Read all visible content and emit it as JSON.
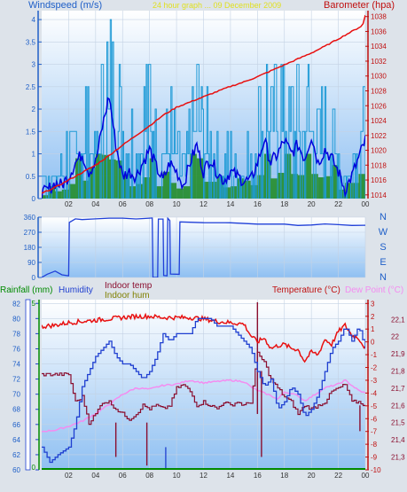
{
  "colors": {
    "page_bg": "#dde3ea",
    "plot_bg_top": "#ffffff",
    "plot_bg_bottom": "#8fc0f2",
    "grid": "#c4d2e4",
    "wind_gust": "#1e9ad6",
    "wind_avg": "#0000dd",
    "wind_bar": "#1d8a1d",
    "barometer": "#e81010",
    "direction": "#2040d8",
    "temperature": "#e81010",
    "dew_point": "#f48cf0",
    "humidity": "#1f3fd0",
    "rainfall": "#008a00",
    "indoor_temp": "#8a0d2e",
    "indoor_hum": "#808000",
    "axis_blue": "#2060c8",
    "axis_red": "#c01010",
    "tick_text": "#333333"
  },
  "chart_data": [
    {
      "type": "line",
      "title": "24 hour graph ... 09 December 2009",
      "y_left_label": "Windspeed (m/s)",
      "y_right_label": "Barometer (hpa)",
      "x_ticks": [
        "02",
        "04",
        "06",
        "08",
        "10",
        "12",
        "14",
        "16",
        "18",
        "20",
        "22",
        "00"
      ],
      "y_left_ticks": [
        "0",
        "0.5",
        "1",
        "1.5",
        "2",
        "2.5",
        "3",
        "3.5",
        "4"
      ],
      "y_left_range": [
        0,
        4.2
      ],
      "y_right_ticks": [
        "1014",
        "1016",
        "1018",
        "1020",
        "1022",
        "1024",
        "1026",
        "1028",
        "1030",
        "1032",
        "1034",
        "1036",
        "1038"
      ],
      "y_right_range": [
        1013.5,
        1038.8
      ],
      "x_range_hours": [
        0,
        24
      ],
      "barometer": [
        [
          0,
          1014.2
        ],
        [
          1,
          1015.0
        ],
        [
          2,
          1016.0
        ],
        [
          3,
          1017.0
        ],
        [
          4,
          1018.0
        ],
        [
          5,
          1019.3
        ],
        [
          6,
          1020.7
        ],
        [
          7,
          1022.0
        ],
        [
          8,
          1023.3
        ],
        [
          9,
          1024.7
        ],
        [
          10,
          1025.8
        ],
        [
          11,
          1026.5
        ],
        [
          12,
          1027.2
        ],
        [
          13,
          1027.9
        ],
        [
          14,
          1028.6
        ],
        [
          15,
          1029.2
        ],
        [
          16,
          1029.9
        ],
        [
          17,
          1030.7
        ],
        [
          18,
          1031.5
        ],
        [
          19,
          1032.3
        ],
        [
          20,
          1033.1
        ],
        [
          21,
          1034.0
        ],
        [
          22,
          1035.0
        ],
        [
          23,
          1036.0
        ],
        [
          23.8,
          1036.8
        ],
        [
          24,
          1038.2
        ]
      ],
      "wind_avg": [
        [
          0,
          0.1
        ],
        [
          0.5,
          0.2
        ],
        [
          1,
          0.35
        ],
        [
          1.5,
          0.3
        ],
        [
          2,
          0.5
        ],
        [
          2.5,
          0.8
        ],
        [
          3,
          1.0
        ],
        [
          3.5,
          0.6
        ],
        [
          4,
          0.8
        ],
        [
          4.5,
          1.6
        ],
        [
          5,
          2.3
        ],
        [
          5.5,
          1.2
        ],
        [
          6,
          0.5
        ],
        [
          6.5,
          0.6
        ],
        [
          7,
          0.5
        ],
        [
          7.5,
          0.8
        ],
        [
          8,
          1.1
        ],
        [
          8.5,
          0.7
        ],
        [
          9,
          0.4
        ],
        [
          9.5,
          0.8
        ],
        [
          10,
          0.6
        ],
        [
          10.5,
          0.3
        ],
        [
          11,
          0.8
        ],
        [
          11.5,
          1.2
        ],
        [
          12,
          0.6
        ],
        [
          12.5,
          0.9
        ],
        [
          13,
          0.6
        ],
        [
          13.5,
          0.4
        ],
        [
          14,
          0.6
        ],
        [
          14.5,
          0.5
        ],
        [
          15,
          0.4
        ],
        [
          15.5,
          0.4
        ],
        [
          16,
          0.8
        ],
        [
          16.5,
          1.3
        ],
        [
          17,
          0.8
        ],
        [
          17.5,
          1.0
        ],
        [
          18,
          1.3
        ],
        [
          18.5,
          1.0
        ],
        [
          19,
          1.2
        ],
        [
          19.5,
          0.9
        ],
        [
          20,
          1.4
        ],
        [
          20.5,
          0.8
        ],
        [
          21,
          1.1
        ],
        [
          21.5,
          0.9
        ],
        [
          22,
          0.6
        ],
        [
          22.5,
          0.2
        ],
        [
          23,
          0.5
        ],
        [
          23.5,
          0.9
        ],
        [
          24,
          1.3
        ]
      ],
      "wind_gust_peaks": [
        [
          0,
          0.5
        ],
        [
          0.5,
          0.5
        ],
        [
          1,
          0.5
        ],
        [
          1.5,
          1.0
        ],
        [
          2,
          1.5
        ],
        [
          2.5,
          1.5
        ],
        [
          3,
          2.0
        ],
        [
          3.5,
          2.5
        ],
        [
          4,
          1.5
        ],
        [
          4.5,
          3.0
        ],
        [
          5,
          4.1
        ],
        [
          5.5,
          3.0
        ],
        [
          6,
          2.5
        ],
        [
          6.5,
          2.0
        ],
        [
          7,
          1.5
        ],
        [
          7.5,
          2.5
        ],
        [
          8,
          3.0
        ],
        [
          8.5,
          2.0
        ],
        [
          9,
          1.5
        ],
        [
          9.5,
          2.5
        ],
        [
          10,
          1.5
        ],
        [
          10.5,
          1.0
        ],
        [
          11,
          2.0
        ],
        [
          11.5,
          3.0
        ],
        [
          12,
          2.0
        ],
        [
          12.5,
          2.5
        ],
        [
          13,
          1.5
        ],
        [
          13.5,
          1.0
        ],
        [
          14,
          1.5
        ],
        [
          14.5,
          1.0
        ],
        [
          15,
          1.5
        ],
        [
          15.5,
          1.0
        ],
        [
          16,
          2.5
        ],
        [
          16.5,
          3.0
        ],
        [
          17,
          2.5
        ],
        [
          17.5,
          3.0
        ],
        [
          18,
          3.0
        ],
        [
          18.5,
          2.5
        ],
        [
          19,
          3.0
        ],
        [
          19.5,
          2.5
        ],
        [
          20,
          3.0
        ],
        [
          20.5,
          2.0
        ],
        [
          21,
          2.5
        ],
        [
          21.5,
          2.0
        ],
        [
          22,
          1.5
        ],
        [
          22.5,
          1.0
        ],
        [
          23,
          1.5
        ],
        [
          23.5,
          2.5
        ],
        [
          24,
          2.5
        ]
      ]
    },
    {
      "type": "line",
      "series_name": "Wind direction",
      "y_left_ticks": [
        "0",
        "90",
        "180",
        "270",
        "360"
      ],
      "y_range": [
        0,
        360
      ],
      "compass_labels": [
        "N",
        "W",
        "S",
        "E",
        "N"
      ],
      "values": [
        [
          0,
          0
        ],
        [
          0.4,
          20
        ],
        [
          1,
          40
        ],
        [
          1.5,
          15
        ],
        [
          2,
          10
        ],
        [
          2.05,
          330
        ],
        [
          2.5,
          350
        ],
        [
          3,
          345
        ],
        [
          4,
          350
        ],
        [
          5,
          355
        ],
        [
          6,
          355
        ],
        [
          7,
          350
        ],
        [
          8,
          355
        ],
        [
          8.2,
          355
        ],
        [
          8.25,
          0
        ],
        [
          8.6,
          0
        ],
        [
          8.65,
          350
        ],
        [
          9.0,
          350
        ],
        [
          9.05,
          10
        ],
        [
          9.3,
          10
        ],
        [
          9.35,
          355
        ],
        [
          9.5,
          340
        ],
        [
          9.55,
          20
        ],
        [
          10.2,
          20
        ],
        [
          10.25,
          330
        ],
        [
          11,
          330
        ],
        [
          12,
          325
        ],
        [
          14,
          325
        ],
        [
          16,
          320
        ],
        [
          18,
          318
        ],
        [
          19,
          310
        ],
        [
          20,
          315
        ],
        [
          21,
          318
        ],
        [
          22,
          315
        ],
        [
          23,
          310
        ],
        [
          24,
          310
        ]
      ]
    },
    {
      "type": "line",
      "y_labels": [
        "Rainfall (mm)",
        "Humidity",
        "Indoor temp",
        "Indoor hum",
        "Temperature (°C)",
        "Dew Point (°C)"
      ],
      "rain_ticks": [
        "0",
        "5"
      ],
      "humidity_ticks": [
        "60",
        "62",
        "64",
        "66",
        "68",
        "70",
        "72",
        "74",
        "76",
        "78",
        "80",
        "82"
      ],
      "humidity_range": [
        60,
        82.5
      ],
      "temperature_ticks": [
        "-10",
        "-9",
        "-8",
        "-7",
        "-6",
        "-5",
        "-4",
        "-3",
        "-2",
        "-1",
        "0",
        "1",
        "2",
        "3"
      ],
      "temperature_range": [
        -10,
        3.3
      ],
      "indoor_ticks": [
        "21,3",
        "21,4",
        "21,5",
        "21,6",
        "21,7",
        "21,8",
        "21,9",
        "22",
        "22,1"
      ],
      "indoor_range": [
        21.225,
        22.215
      ],
      "x_ticks": [
        "02",
        "04",
        "06",
        "08",
        "10",
        "12",
        "14",
        "16",
        "18",
        "20",
        "22",
        "00"
      ],
      "temperature": [
        [
          0,
          1.2
        ],
        [
          1,
          1.3
        ],
        [
          2,
          1.5
        ],
        [
          3,
          1.6
        ],
        [
          4,
          1.7
        ],
        [
          5,
          1.8
        ],
        [
          6,
          1.9
        ],
        [
          7,
          2.0
        ],
        [
          8,
          2.0
        ],
        [
          9,
          1.9
        ],
        [
          10,
          1.9
        ],
        [
          11,
          1.9
        ],
        [
          12,
          1.8
        ],
        [
          13,
          1.6
        ],
        [
          14,
          1.5
        ],
        [
          15,
          1.4
        ],
        [
          15.5,
          0.5
        ],
        [
          16,
          0.0
        ],
        [
          16.5,
          0.3
        ],
        [
          17,
          -0.5
        ],
        [
          17.5,
          -0.3
        ],
        [
          18,
          -0.2
        ],
        [
          18.5,
          -0.5
        ],
        [
          19,
          -0.6
        ],
        [
          19.5,
          -1.5
        ],
        [
          20,
          -0.8
        ],
        [
          20.5,
          -1.0
        ],
        [
          21,
          0.2
        ],
        [
          21.5,
          -0.2
        ],
        [
          22,
          0.8
        ],
        [
          22.5,
          1.3
        ],
        [
          23,
          0.5
        ],
        [
          23.5,
          0.3
        ],
        [
          24,
          -0.5
        ]
      ],
      "dew_point": [
        [
          0,
          -7.0
        ],
        [
          1,
          -6.9
        ],
        [
          2,
          -6.6
        ],
        [
          3,
          -6.2
        ],
        [
          4,
          -5.6
        ],
        [
          5,
          -4.9
        ],
        [
          6,
          -4.1
        ],
        [
          7,
          -3.6
        ],
        [
          8,
          -3.7
        ],
        [
          9,
          -3.4
        ],
        [
          10,
          -3.3
        ],
        [
          11,
          -3.0
        ],
        [
          12,
          -3.2
        ],
        [
          13,
          -3.1
        ],
        [
          14,
          -3.0
        ],
        [
          15,
          -3.1
        ],
        [
          15.5,
          -3.5
        ],
        [
          16,
          -3.8
        ],
        [
          17,
          -4.2
        ],
        [
          17.5,
          -4.5
        ],
        [
          18,
          -3.9
        ],
        [
          19,
          -4.2
        ],
        [
          19.5,
          -4.6
        ],
        [
          20,
          -4.3
        ],
        [
          21,
          -3.6
        ],
        [
          22,
          -3.3
        ],
        [
          22.5,
          -3.0
        ],
        [
          23,
          -3.4
        ],
        [
          23.5,
          -3.8
        ],
        [
          24,
          -4.0
        ]
      ],
      "humidity": [
        [
          0,
          63
        ],
        [
          0.6,
          61
        ],
        [
          1.2,
          62
        ],
        [
          2,
          63
        ],
        [
          2.5,
          66
        ],
        [
          3,
          71
        ],
        [
          3.5,
          73
        ],
        [
          4,
          75
        ],
        [
          4.5,
          76
        ],
        [
          5,
          77
        ],
        [
          5.5,
          75
        ],
        [
          6,
          74
        ],
        [
          6.5,
          74
        ],
        [
          7,
          73
        ],
        [
          7.5,
          72
        ],
        [
          8,
          73
        ],
        [
          8.5,
          75
        ],
        [
          9,
          78
        ],
        [
          9.5,
          77
        ],
        [
          10,
          78
        ],
        [
          11,
          78
        ],
        [
          11.5,
          80
        ],
        [
          12,
          80
        ],
        [
          12.5,
          80
        ],
        [
          13,
          79
        ],
        [
          14,
          79
        ],
        [
          14.5,
          78
        ],
        [
          15,
          77
        ],
        [
          15.5,
          76
        ],
        [
          16,
          73
        ],
        [
          16.5,
          71
        ],
        [
          17,
          72
        ],
        [
          17.5,
          68
        ],
        [
          18,
          69
        ],
        [
          18.5,
          71
        ],
        [
          19,
          70
        ],
        [
          19.5,
          67
        ],
        [
          20,
          68
        ],
        [
          20.5,
          70
        ],
        [
          21,
          73
        ],
        [
          21.5,
          76
        ],
        [
          22,
          77
        ],
        [
          22.5,
          79
        ],
        [
          23,
          77
        ],
        [
          23.5,
          79
        ],
        [
          24,
          76
        ]
      ],
      "indoor_temp": [
        [
          0,
          21.78
        ],
        [
          1,
          21.78
        ],
        [
          2,
          21.78
        ],
        [
          2.5,
          21.62
        ],
        [
          3,
          21.65
        ],
        [
          3.5,
          21.5
        ],
        [
          4,
          21.55
        ],
        [
          4.5,
          21.62
        ],
        [
          5,
          21.62
        ],
        [
          5.5,
          21.58
        ],
        [
          6,
          21.55
        ],
        [
          6.5,
          21.52
        ],
        [
          7,
          21.55
        ],
        [
          7.5,
          21.6
        ],
        [
          8,
          21.58
        ],
        [
          8.5,
          21.6
        ],
        [
          9,
          21.58
        ],
        [
          9.5,
          21.6
        ],
        [
          10,
          21.7
        ],
        [
          10.5,
          21.72
        ],
        [
          11,
          21.68
        ],
        [
          11.5,
          21.6
        ],
        [
          12,
          21.62
        ],
        [
          12.5,
          21.6
        ],
        [
          13,
          21.58
        ],
        [
          13.5,
          21.62
        ],
        [
          14,
          21.6
        ],
        [
          14.5,
          21.62
        ],
        [
          15,
          21.6
        ],
        [
          15.5,
          21.62
        ],
        [
          16,
          21.9
        ],
        [
          16.5,
          21.85
        ],
        [
          17,
          21.75
        ],
        [
          17.5,
          21.7
        ],
        [
          18,
          21.65
        ],
        [
          18.5,
          21.62
        ],
        [
          19,
          21.55
        ],
        [
          19.5,
          21.6
        ],
        [
          20,
          21.58
        ],
        [
          20.5,
          21.6
        ],
        [
          21,
          21.62
        ],
        [
          21.5,
          21.68
        ],
        [
          22,
          21.7
        ],
        [
          22.5,
          21.72
        ],
        [
          23,
          21.62
        ],
        [
          23.5,
          21.62
        ],
        [
          24,
          21.6
        ]
      ],
      "rainfall": [
        [
          0,
          0
        ],
        [
          24,
          0
        ]
      ]
    }
  ]
}
